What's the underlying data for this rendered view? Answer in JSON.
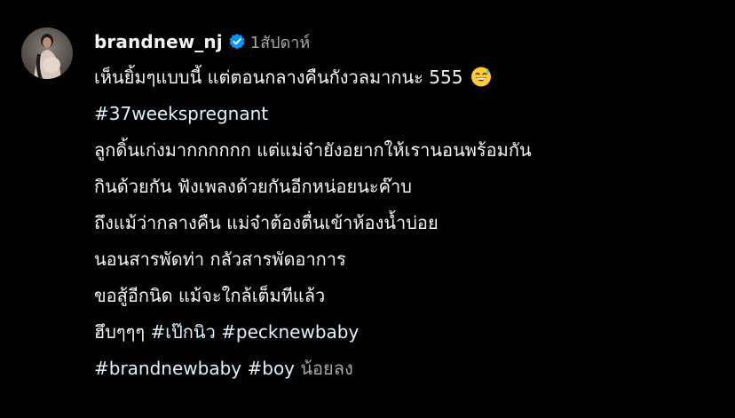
{
  "post": {
    "username": "brandnew_nj",
    "time": "1สัปดาห์",
    "verified_icon": "verified-badge-icon",
    "avatar_icon": "profile-photo",
    "colors": {
      "background": "#000000",
      "text": "#f5f5f5",
      "muted": "#a8a8a8",
      "hashtag": "#e0f1ff",
      "verified": "#0095f6"
    },
    "caption": {
      "line1_text": "เห็นยิ้มๆแบบนี้ แต่ตอนกลางคืนกังวลมากนะ 555",
      "line1_emoji": "grinning-sweat-emoji",
      "line2_hashtag": "#37weekspregnant",
      "line3": "ลูกดิ้นเก่งมากกกกกก แต่แม่จ๋ายังอยากให้เรานอนพร้อมกัน",
      "line4": "กินด้วยกัน ฟังเพลงด้วยกันอีกหน่อยนะค๊าบ",
      "line5": "ถึงแม้ว่ากลางคืน แม่จ๋าต้องตื่นเข้าห้องน้ำบ่อย",
      "line6": "นอนสารพัดท่า กลัวสารพัดอาการ",
      "line7": "ขอสู้อีกนิด แม้จะใกล้เต็มทีแล้ว",
      "line8_text": "ฮึบๆๆๆ",
      "line8_hashtag1": "#เป๊กนิว",
      "line8_hashtag2": "#pecknewbaby",
      "line9_hashtag1": "#brandnewbaby",
      "line9_hashtag2": "#boy",
      "line9_less": "น้อยลง"
    }
  }
}
